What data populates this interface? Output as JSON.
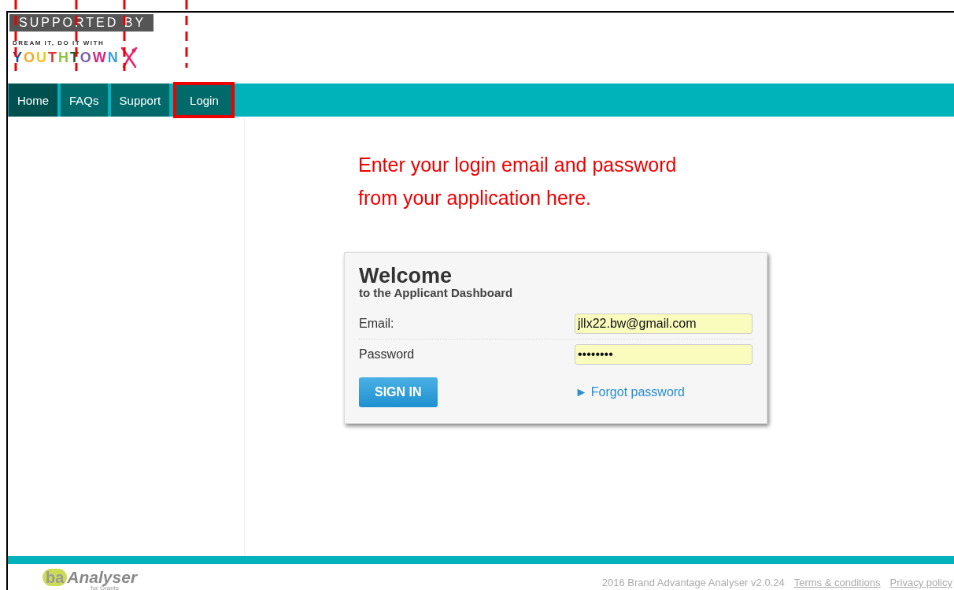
{
  "logo": {
    "badge": "SUPPORTED BY",
    "tagline": "DREAM IT, DO IT WITH",
    "brand": [
      {
        "letter": "Y",
        "color": "#1f4e9c"
      },
      {
        "letter": "O",
        "color": "#f5a623"
      },
      {
        "letter": "U",
        "color": "#f7c51e"
      },
      {
        "letter": "T",
        "color": "#e2312d"
      },
      {
        "letter": "H",
        "color": "#8cc63f"
      },
      {
        "letter": "T",
        "color": "#1d5a2c"
      },
      {
        "letter": "O",
        "color": "#7b5ea7"
      },
      {
        "letter": "W",
        "color": "#d7267b"
      },
      {
        "letter": "N",
        "color": "#3aa0d8"
      }
    ]
  },
  "nav": [
    {
      "label": "Home",
      "selected": true,
      "highlighted": false
    },
    {
      "label": "FAQs",
      "selected": false,
      "highlighted": false
    },
    {
      "label": "Support",
      "selected": false,
      "highlighted": false
    },
    {
      "label": "Login",
      "selected": false,
      "highlighted": true
    }
  ],
  "annotation": "Enter your login email and password from your application here.",
  "login": {
    "title": "Welcome",
    "subtitle": "to the Applicant Dashboard",
    "fields": [
      {
        "label": "Email:",
        "value": "jllx22.bw@gmail.com"
      },
      {
        "label": "Password",
        "value": "••••••••"
      }
    ],
    "button": "SIGN IN",
    "forgot": "► Forgot password"
  },
  "footer": {
    "logo_mark": "ba",
    "logo_name": "Analyser",
    "logo_sub": "for Grants",
    "copyright": "2016 Brand Advantage Analyser v2.0.24",
    "links": [
      "Terms & conditions",
      "Privacy policy"
    ]
  }
}
